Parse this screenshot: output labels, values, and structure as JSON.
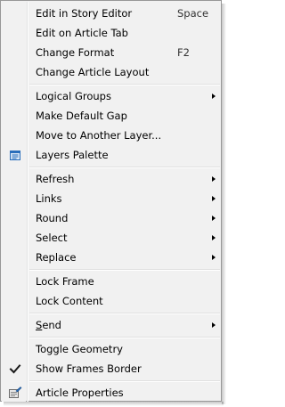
{
  "menu": {
    "edit_story": "Edit in Story Editor",
    "edit_story_shortcut": "Space",
    "edit_article_tab": "Edit on Article Tab",
    "change_format": "Change Format",
    "change_format_shortcut": "F2",
    "change_layout": "Change Article Layout",
    "logical_groups": "Logical Groups",
    "make_default_gap": "Make Default Gap",
    "move_layer": "Move to Another Layer...",
    "layers_palette": "Layers Palette",
    "refresh": "Refresh",
    "links": "Links",
    "round": "Round",
    "select": "Select",
    "replace": "Replace",
    "lock_frame": "Lock Frame",
    "lock_content": "Lock Content",
    "send_first": "S",
    "send_rest": "end",
    "toggle_geometry": "Toggle Geometry",
    "show_frames_border": "Show Frames Border",
    "article_properties": "Article Properties"
  },
  "icons": {
    "layers_palette": "layers-palette-icon",
    "show_frames_border": "checkmark-icon",
    "article_properties": "article-properties-icon",
    "submenu": "submenu-arrow-icon"
  },
  "state": {
    "show_frames_border_checked": true
  },
  "colors": {
    "menu_bg": "#f1f1f1",
    "border": "#979797",
    "icon_blue": "#2a6ebb"
  }
}
